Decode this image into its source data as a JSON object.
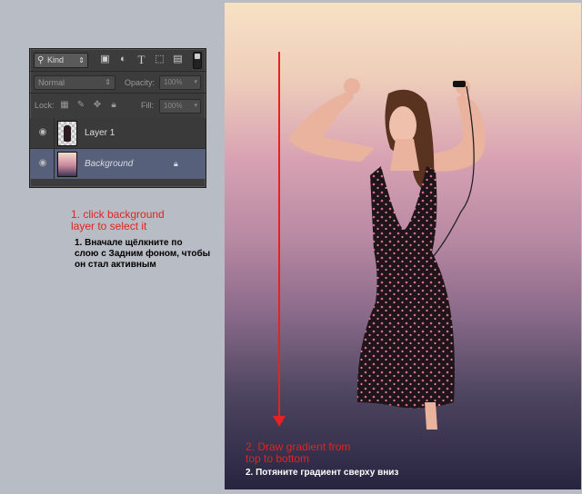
{
  "layers_panel": {
    "filter_kind": "Kind",
    "filter_icons": [
      "image-filter-icon",
      "adjustment-filter-icon",
      "type-filter-icon",
      "shape-filter-icon",
      "smart-object-filter-icon"
    ],
    "blend_mode": "Normal",
    "opacity_label": "Opacity:",
    "opacity_value": "100%",
    "lock_label": "Lock:",
    "fill_label": "Fill:",
    "fill_value": "100%",
    "layers": [
      {
        "name": "Layer 1",
        "visible": true,
        "selected": false
      },
      {
        "name": "Background",
        "visible": true,
        "selected": true,
        "locked": true
      }
    ]
  },
  "annotations": {
    "step1_en": [
      "1. click background",
      "layer to select it"
    ],
    "step1_ru": [
      "1. Вначале щёлкните по",
      "слою с Задним фоном, чтобы",
      "он стал активным"
    ],
    "step2_en": [
      "2. Draw gradient from",
      "top to bottom"
    ],
    "step2_ru": "2. Потяните градиент сверху вниз"
  },
  "colors": {
    "annotation_red": "#e3231f",
    "gradient_top": "#f7e1c4",
    "gradient_mid": "#c48ea6",
    "gradient_bottom": "#272440",
    "selected_layer": "#56607a"
  }
}
